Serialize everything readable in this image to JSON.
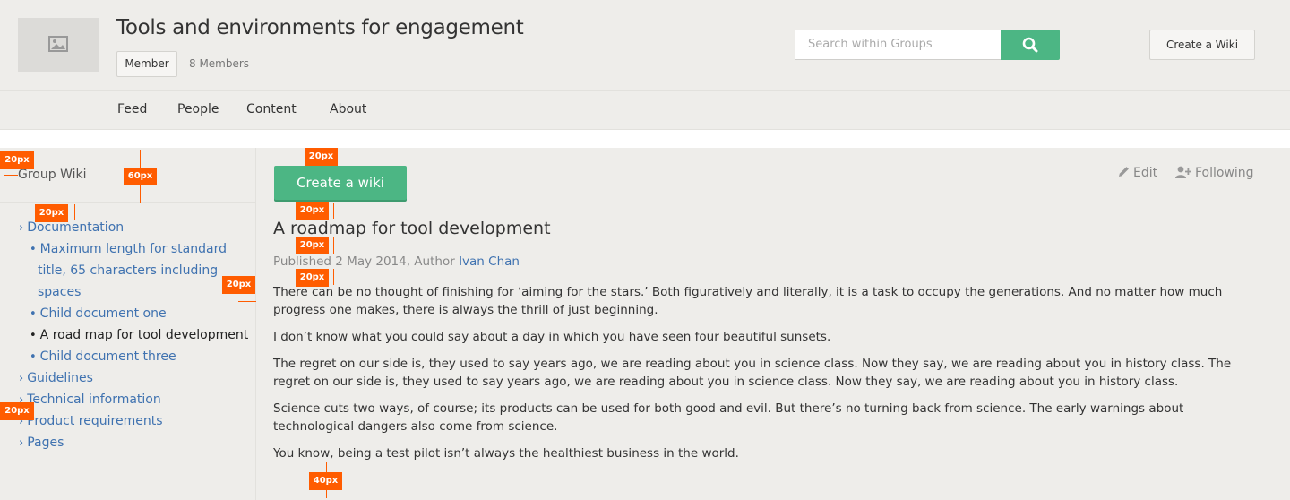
{
  "header": {
    "group_title": "Tools and environments for engagement",
    "member_label": "Member",
    "members_count": "8 Members",
    "search_placeholder": "Search within Groups",
    "create_wiki_label": "Create a Wiki",
    "nav": [
      "Feed",
      "People",
      "Content",
      "About"
    ]
  },
  "sidebar": {
    "title": "Group Wiki",
    "items": [
      {
        "label": "Documentation",
        "marker": "›"
      },
      {
        "label": "Maximum length for standard",
        "marker": "•"
      },
      {
        "label": "title, 65 characters including",
        "marker": ""
      },
      {
        "label": "spaces",
        "marker": ""
      },
      {
        "label": "Child document one",
        "marker": "•"
      },
      {
        "label": "A road map for tool development",
        "marker": "•"
      },
      {
        "label": "Child document three",
        "marker": "•"
      },
      {
        "label": "Guidelines",
        "marker": "›"
      },
      {
        "label": "Technical information",
        "marker": "›"
      },
      {
        "label": "Product requirements",
        "marker": "›"
      },
      {
        "label": "Pages",
        "marker": "›"
      }
    ]
  },
  "main": {
    "create_button": "Create a wiki",
    "edit_label": "Edit",
    "following_label": "Following",
    "article_title": "A roadmap for tool development",
    "published_prefix": "Published 2 May 2014, Author ",
    "author": "Ivan Chan",
    "paragraphs": [
      "There can be no thought of finishing for ‘aiming for the stars.’ Both figuratively and literally, it is a task to occupy the generations. And no matter how much progress one makes, there is always the thrill of just beginning.",
      "I don’t know what you could say about a day in which you have seen four beautiful sunsets.",
      "The regret on our side is, they used to say years ago, we are reading about you in science class. Now they say, we are reading about you in history class. The regret on our side is, they used to say years ago, we are reading about you in science class. Now they say, we are reading about you in history class.",
      "Science cuts two ways, of course; its products can be used for both good and evil. But there’s no turning back from science. The early warnings about technological dangers also come from science.",
      "You know, being a test pilot isn’t always the healthiest business in the world."
    ]
  },
  "annotations": [
    "20px",
    "60px",
    "20px",
    "20px",
    "20px",
    "20px",
    "20px",
    "20px",
    "20px",
    "40px"
  ],
  "colors": {
    "accent": "#4cb684",
    "link": "#3f72b0",
    "annotation": "#ff5c00",
    "background": "#eeedea"
  }
}
